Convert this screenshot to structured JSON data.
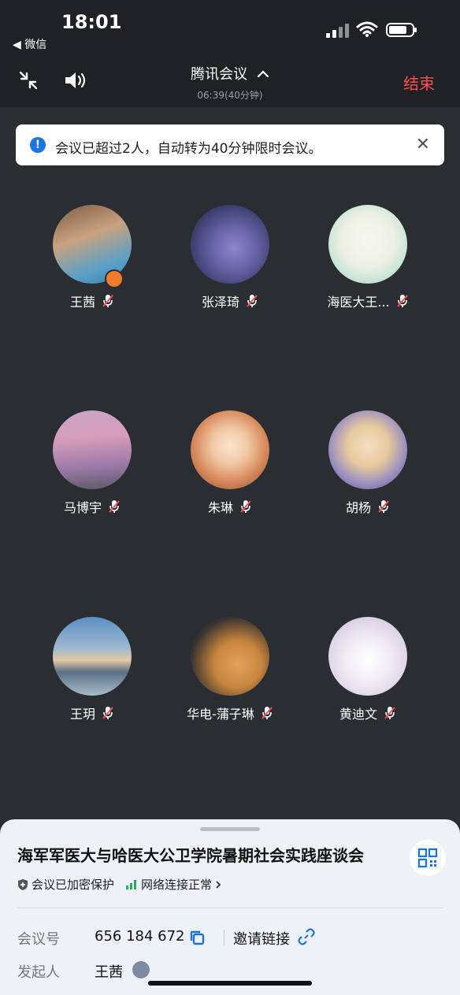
{
  "status_bar": {
    "time": "18:01",
    "back_app": "◀ 微信"
  },
  "toolbar": {
    "title": "腾讯会议",
    "timer": "06:39(40分钟)",
    "end_label": "结束"
  },
  "notice": {
    "text": "会议已超过2人，自动转为40分钟限时会议。",
    "icon": "info-icon"
  },
  "participants": [
    {
      "name": "王茜",
      "host": true
    },
    {
      "name": "张泽琦"
    },
    {
      "name": "海医大王..."
    },
    {
      "name": "马博宇"
    },
    {
      "name": "朱琳"
    },
    {
      "name": "胡杨"
    },
    {
      "name": "王玥"
    },
    {
      "name": "华电-蒲子琳"
    },
    {
      "name": "黄迪文"
    }
  ],
  "sheet": {
    "title": "海军军医大与哈医大公卫学院暑期社会实践座谈会",
    "tag_encrypted": "会议已加密保护",
    "tag_network": "网络连接正常",
    "meeting_id_label": "会议号",
    "meeting_id": "656 184 672",
    "invite_label": "邀请链接",
    "host_label": "发起人",
    "host_name": "王茜"
  },
  "colors": {
    "accent": "#1a73e8",
    "end_red": "#ff4d4f",
    "background": "#2a2d31"
  }
}
